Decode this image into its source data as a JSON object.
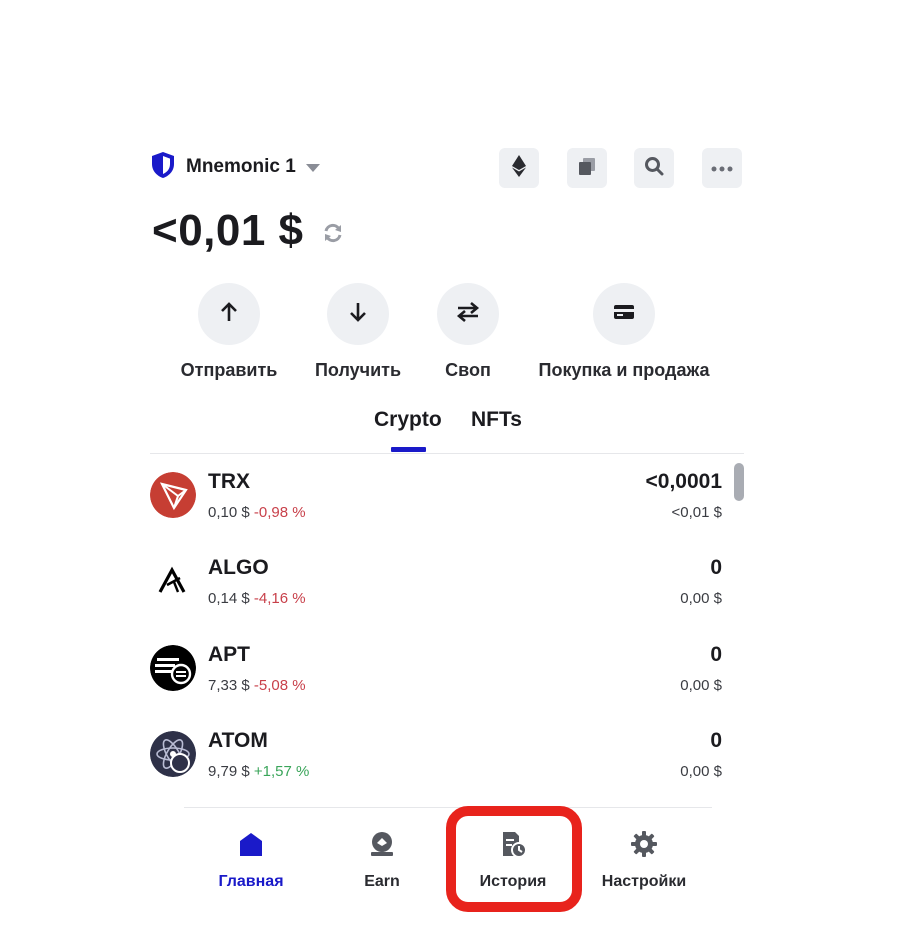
{
  "header": {
    "wallet_name": "Mnemonic 1",
    "icons": [
      "eth-icon",
      "copy-icon",
      "search-icon",
      "more-icon"
    ]
  },
  "balance": {
    "amount": "<0,01 $"
  },
  "actions": [
    {
      "label": "Отправить",
      "icon": "arrow-up-icon"
    },
    {
      "label": "Получить",
      "icon": "arrow-down-icon"
    },
    {
      "label": "Своп",
      "icon": "swap-icon"
    },
    {
      "label": "Покупка и продажа",
      "icon": "card-icon"
    }
  ],
  "tabs": [
    {
      "label": "Crypto",
      "active": true
    },
    {
      "label": "NFTs",
      "active": false
    }
  ],
  "assets": [
    {
      "symbol": "TRX",
      "price": "0,10 $",
      "change": "-0,98 %",
      "amount": "<0,0001",
      "fiat": "<0,01 $",
      "icon": "trx-icon",
      "color": "#c63e33"
    },
    {
      "symbol": "ALGO",
      "price": "0,14 $",
      "change": "-4,16 %",
      "amount": "0",
      "fiat": "0,00 $",
      "icon": "algo-icon",
      "color": "#000000"
    },
    {
      "symbol": "APT",
      "price": "7,33 $",
      "change": "-5,08 %",
      "amount": "0",
      "fiat": "0,00 $",
      "icon": "apt-icon",
      "color": "#000000"
    },
    {
      "symbol": "ATOM",
      "price": "9,79 $",
      "change": "+1,57 %",
      "amount": "0",
      "fiat": "0,00 $",
      "icon": "atom-icon",
      "color": "#2e3148"
    }
  ],
  "nav": [
    {
      "label": "Главная",
      "icon": "home-icon",
      "active": true
    },
    {
      "label": "Earn",
      "icon": "earn-icon",
      "active": false
    },
    {
      "label": "История",
      "icon": "history-icon",
      "active": false,
      "highlighted": true
    },
    {
      "label": "Настройки",
      "icon": "settings-icon",
      "active": false
    }
  ],
  "colors": {
    "accent": "#1a1ac9",
    "negative": "#c8404a",
    "positive": "#3aa55a",
    "highlight": "#e8231c"
  }
}
